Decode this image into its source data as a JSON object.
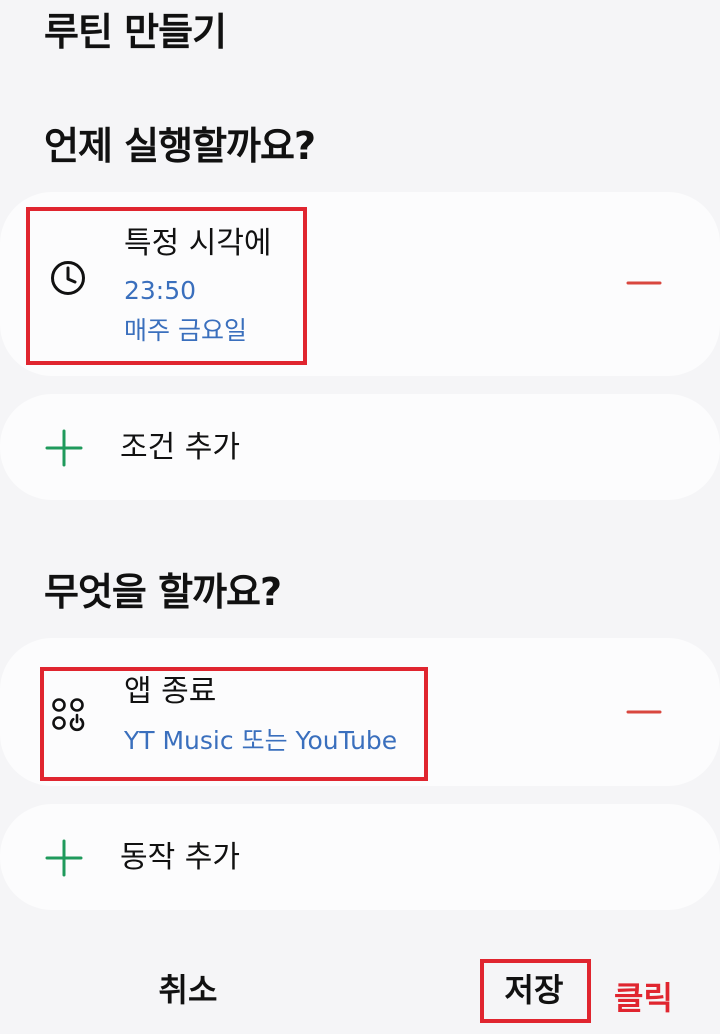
{
  "header": {
    "title": "루틴 만들기"
  },
  "when_section": {
    "title": "언제 실행할까요?",
    "condition": {
      "icon": "clock-icon",
      "title": "특정 시각에",
      "time": "23:50",
      "repeat": "매주 금요일"
    },
    "add_label": "조건 추가"
  },
  "what_section": {
    "title": "무엇을 할까요?",
    "action": {
      "icon": "apps-close-icon",
      "title": "앱 종료",
      "detail": "YT Music 또는 YouTube"
    },
    "add_label": "동작 추가"
  },
  "footer": {
    "cancel_label": "취소",
    "save_label": "저장",
    "click_annotation": "클릭"
  },
  "colors": {
    "accent_blue": "#3a6fbd",
    "remove_red": "#d9473f",
    "add_green": "#1f9a5c",
    "highlight_red": "#e0252f"
  }
}
